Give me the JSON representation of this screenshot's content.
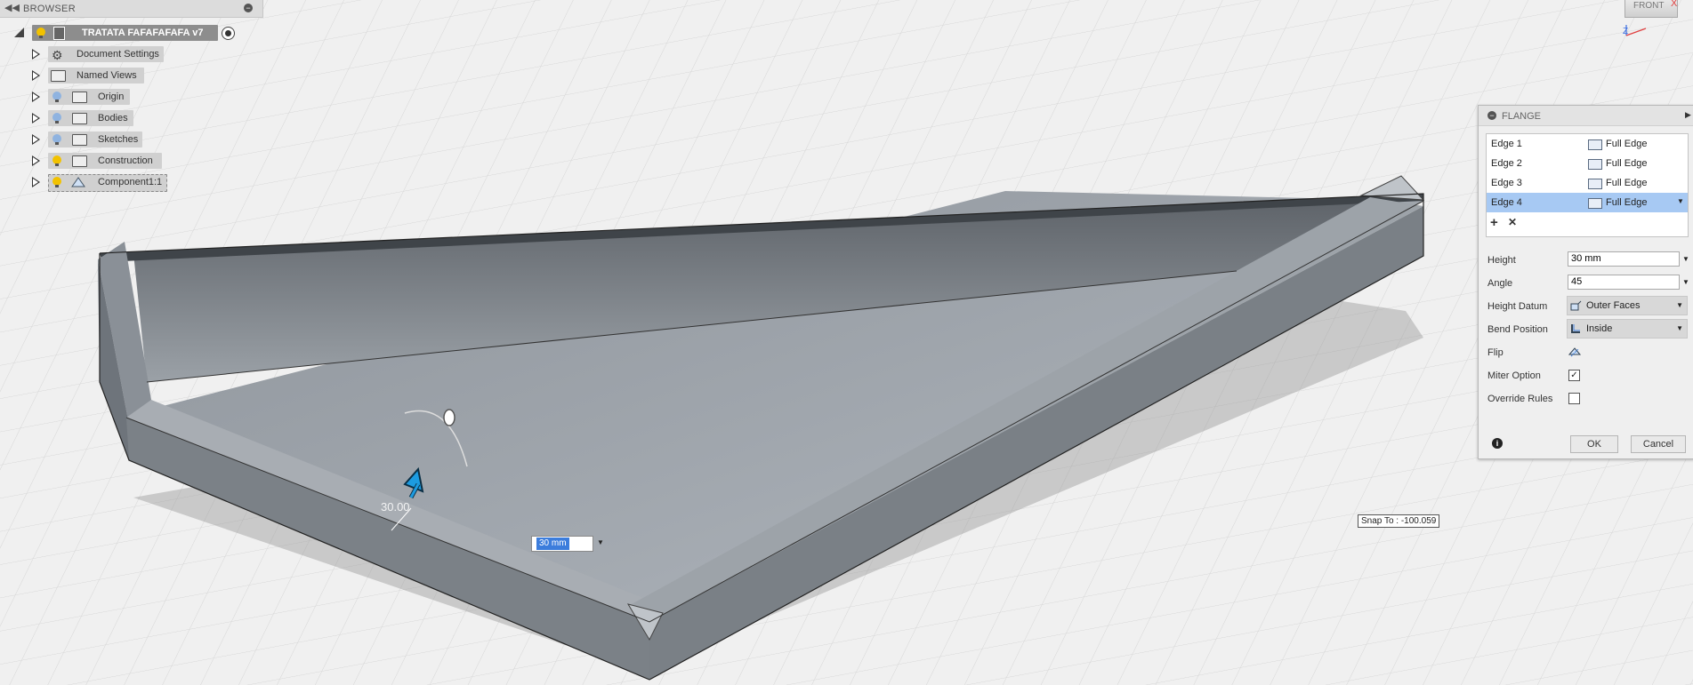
{
  "browser": {
    "title": "BROWSER",
    "collapse_glyph": "◀◀",
    "minus": "−",
    "root": {
      "label": "TRATATA  FAFAFAFAFA v7"
    },
    "items": [
      {
        "label": "Document Settings",
        "icon": "gear-icon"
      },
      {
        "label": "Named Views",
        "icon": "folder-icon"
      },
      {
        "label": "Origin",
        "icon": "folder-icon"
      },
      {
        "label": "Bodies",
        "icon": "folder-icon"
      },
      {
        "label": "Sketches",
        "icon": "folder-icon"
      },
      {
        "label": "Construction",
        "icon": "folder-icon"
      },
      {
        "label": "Component1:1",
        "icon": "component-icon"
      }
    ]
  },
  "flange": {
    "title": "FLANGE",
    "edges": [
      {
        "name": "Edge 1",
        "type": "Full Edge"
      },
      {
        "name": "Edge 2",
        "type": "Full Edge"
      },
      {
        "name": "Edge 3",
        "type": "Full Edge"
      },
      {
        "name": "Edge 4",
        "type": "Full Edge",
        "selected": true
      }
    ],
    "add_glyph": "+",
    "remove_glyph": "✕",
    "height_label": "Height",
    "height_value": "30 mm",
    "angle_label": "Angle",
    "angle_value": "45",
    "height_datum_label": "Height Datum",
    "height_datum_value": "Outer Faces",
    "bend_position_label": "Bend Position",
    "bend_position_value": "Inside",
    "flip_label": "Flip",
    "miter_label": "Miter Option",
    "miter_checked": true,
    "override_label": "Override Rules",
    "override_checked": false,
    "ok_label": "OK",
    "cancel_label": "Cancel",
    "info_glyph": "i"
  },
  "viewport": {
    "snap_text": "Snap To : -100.059",
    "dim_input_value": "30 mm",
    "dim_label": "30.00",
    "viewcube_label": "FRONT",
    "axis_x": "X",
    "axis_z": "Z"
  },
  "colors": {
    "selection": "#a7c9f3",
    "accent": "#3c7ddc",
    "bulb_on": "#f2c200",
    "bulb_off": "#8fb3e0"
  }
}
